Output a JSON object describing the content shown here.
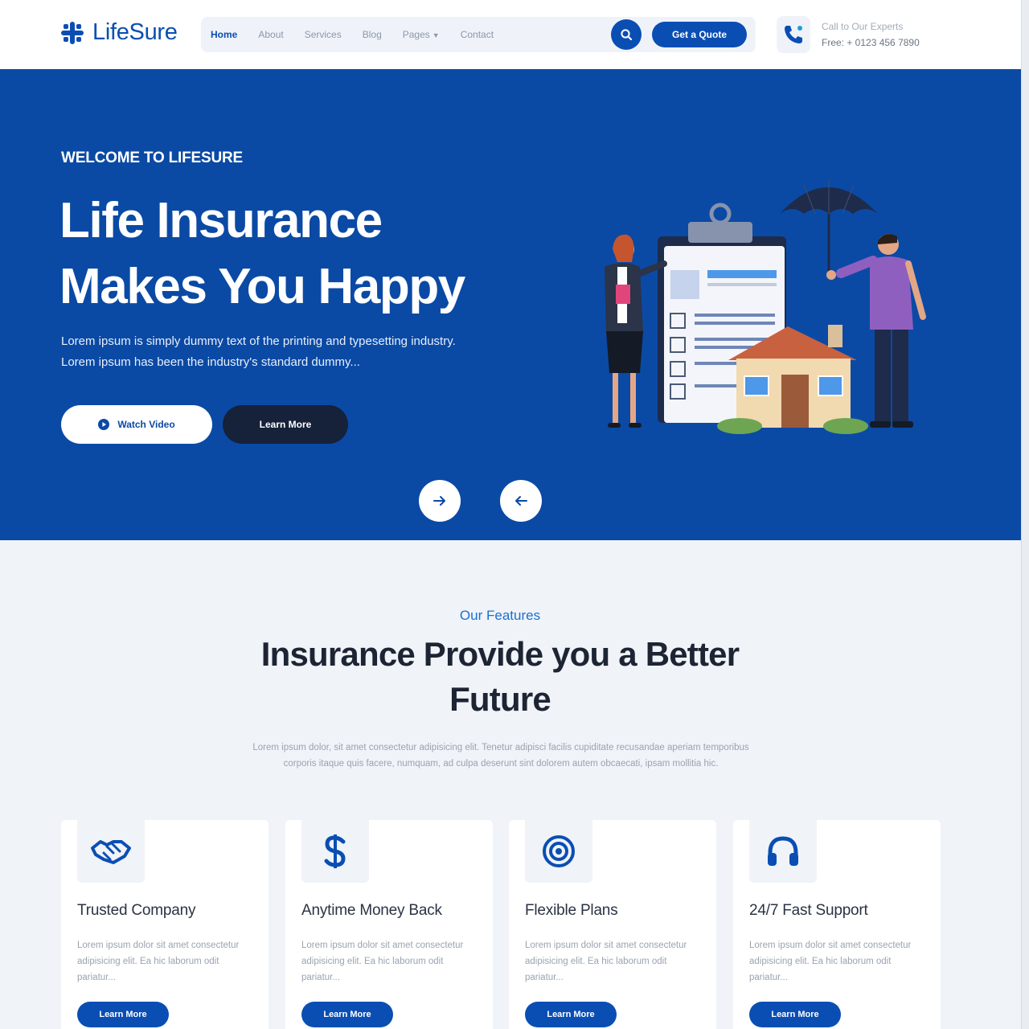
{
  "header": {
    "logo_text": "LifeSure",
    "nav": [
      {
        "label": "Home",
        "active": true
      },
      {
        "label": "About"
      },
      {
        "label": "Services"
      },
      {
        "label": "Blog"
      },
      {
        "label": "Pages"
      },
      {
        "label": "Contact"
      }
    ],
    "quote_button": "Get a Quote",
    "call_label": "Call to Our Experts",
    "call_number": "Free: + 0123 456 7890"
  },
  "hero": {
    "kicker": "WELCOME TO LIFESURE",
    "title_line1": "Life Insurance",
    "title_line2": "Makes You Happy",
    "desc_line1": "Lorem ipsum is simply dummy text of the printing and typesetting industry.",
    "desc_line2": "Lorem ipsum has been the industry's standard dummy...",
    "watch_button": "Watch Video",
    "learn_button": "Learn More"
  },
  "features": {
    "kicker": "Our Features",
    "title_line1": "Insurance Provide you a Better",
    "title_line2": "Future",
    "desc": "Lorem ipsum dolor, sit amet consectetur adipisicing elit. Tenetur adipisci facilis cupiditate recusandae aperiam temporibus corporis itaque quis facere, numquam, ad culpa deserunt sint dolorem autem obcaecati, ipsam mollitia hic.",
    "cards": [
      {
        "icon": "handshake-icon",
        "title": "Trusted Company",
        "text": "Lorem ipsum dolor sit amet consectetur adipisicing elit. Ea hic laborum odit pariatur...",
        "button": "Learn More"
      },
      {
        "icon": "dollar-icon",
        "title": "Anytime Money Back",
        "text": "Lorem ipsum dolor sit amet consectetur adipisicing elit. Ea hic laborum odit pariatur...",
        "button": "Learn More"
      },
      {
        "icon": "target-icon",
        "title": "Flexible Plans",
        "text": "Lorem ipsum dolor sit amet consectetur adipisicing elit. Ea hic laborum odit pariatur...",
        "button": "Learn More"
      },
      {
        "icon": "headphones-icon",
        "title": "24/7 Fast Support",
        "text": "Lorem ipsum dolor sit amet consectetur adipisicing elit. Ea hic laborum odit pariatur...",
        "button": "Learn More"
      }
    ]
  },
  "colors": {
    "primary": "#0a4eb4",
    "hero_bg": "#0a4aa5",
    "dark_button": "#16213a",
    "section_bg": "#f0f3f8"
  }
}
